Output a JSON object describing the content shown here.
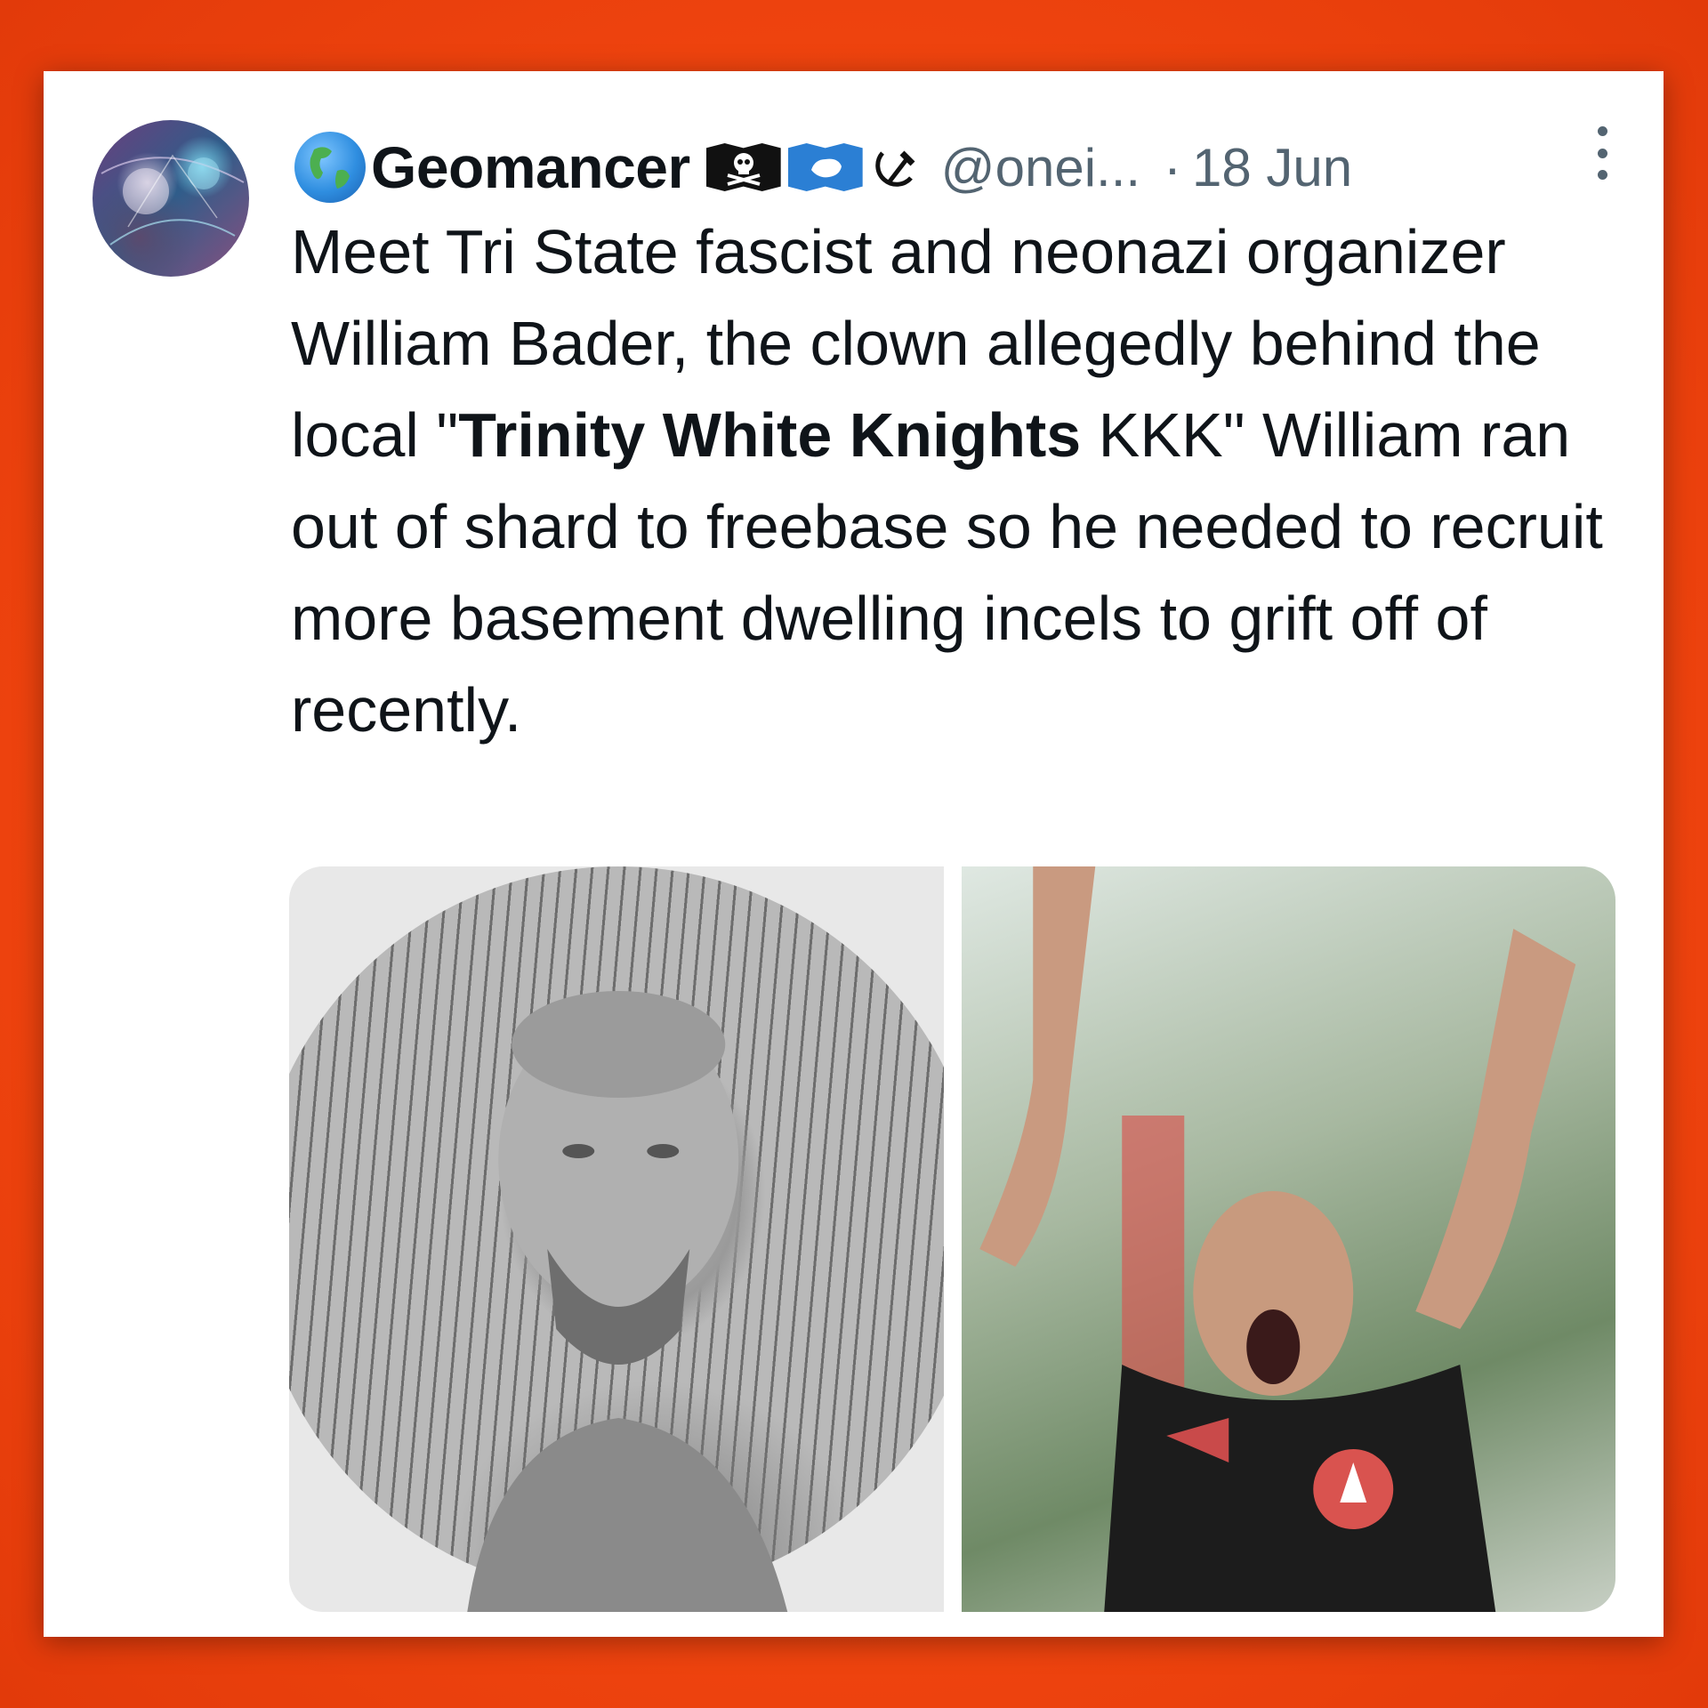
{
  "post": {
    "display_name": "Geomancer",
    "handle": "@onei...",
    "separator": "·",
    "date": "18 Jun",
    "text": {
      "part1": "Meet Tri State fascist and neonazi organizer William Bader, the clown allegedly behind the local \"",
      "bold1": "Trinity White Knights",
      "part2": " KKK\"  William ran out of shard to freebase so he needed to recruit more basement dwelling incels to grift off of recently."
    },
    "media": [
      {
        "name": "photo-left"
      },
      {
        "name": "photo-right"
      }
    ]
  },
  "icons": {
    "globe": "globe-americas-emoji",
    "flag1": "pirate-flag-emoji",
    "flag2": "antarctica-flag-emoji",
    "symbol": "hammer-and-sickle-emoji",
    "more": "more-vertical-icon"
  },
  "colors": {
    "background": "#f1450f",
    "card": "#ffffff",
    "text_primary": "#0f1419",
    "text_secondary": "#536471"
  }
}
